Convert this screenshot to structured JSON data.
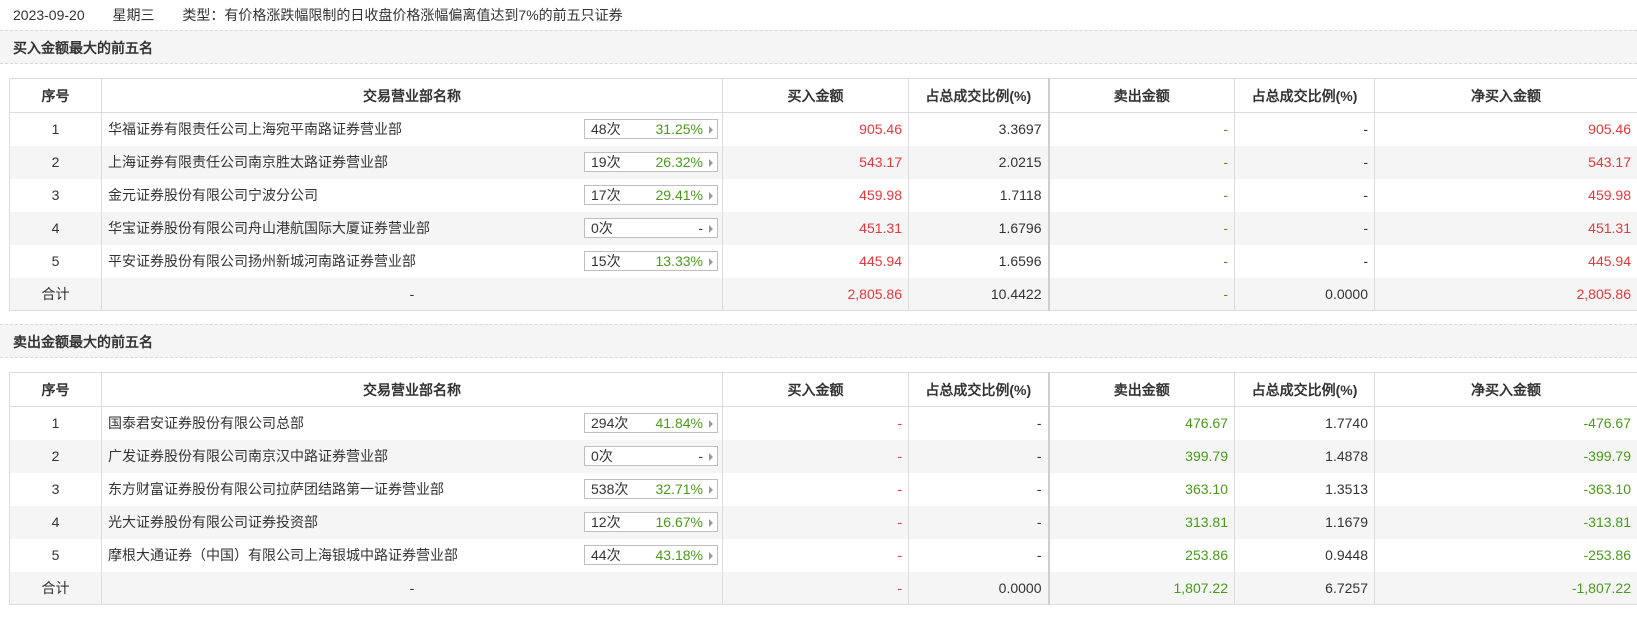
{
  "header": {
    "date": "2023-09-20",
    "weekday": "星期三",
    "type_text": "类型：有价格涨跌幅限制的日收盘价格涨幅偏离值达到7%的前五只证券"
  },
  "columns": [
    "序号",
    "交易营业部名称",
    "买入金额",
    "占总成交比例(%)",
    "卖出金额",
    "占总成交比例(%)",
    "净买入金额"
  ],
  "colors": {
    "red": "#e4393c",
    "green": "#4a9a1a"
  },
  "buy_section": {
    "title": "买入金额最大的前五名",
    "rows": [
      {
        "idx": "1",
        "name": "华福证券有限责任公司上海宛平南路证券营业部",
        "count": "48次",
        "rate": "31.25%",
        "buy": "905.46",
        "buy_pct": "3.3697",
        "sell": "-",
        "sell_pct": "-",
        "net": "905.46"
      },
      {
        "idx": "2",
        "name": "上海证券有限责任公司南京胜太路证券营业部",
        "count": "19次",
        "rate": "26.32%",
        "buy": "543.17",
        "buy_pct": "2.0215",
        "sell": "-",
        "sell_pct": "-",
        "net": "543.17"
      },
      {
        "idx": "3",
        "name": "金元证券股份有限公司宁波分公司",
        "count": "17次",
        "rate": "29.41%",
        "buy": "459.98",
        "buy_pct": "1.7118",
        "sell": "-",
        "sell_pct": "-",
        "net": "459.98"
      },
      {
        "idx": "4",
        "name": "华宝证券股份有限公司舟山港航国际大厦证券营业部",
        "count": "0次",
        "rate": "-",
        "buy": "451.31",
        "buy_pct": "1.6796",
        "sell": "-",
        "sell_pct": "-",
        "net": "451.31"
      },
      {
        "idx": "5",
        "name": "平安证券股份有限公司扬州新城河南路证券营业部",
        "count": "15次",
        "rate": "13.33%",
        "buy": "445.94",
        "buy_pct": "1.6596",
        "sell": "-",
        "sell_pct": "-",
        "net": "445.94"
      }
    ],
    "total": {
      "label": "合计",
      "name": "-",
      "buy": "2,805.86",
      "buy_pct": "10.4422",
      "sell": "-",
      "sell_pct": "0.0000",
      "net": "2,805.86"
    }
  },
  "sell_section": {
    "title": "卖出金额最大的前五名",
    "rows": [
      {
        "idx": "1",
        "name": "国泰君安证券股份有限公司总部",
        "count": "294次",
        "rate": "41.84%",
        "buy": "-",
        "buy_pct": "-",
        "sell": "476.67",
        "sell_pct": "1.7740",
        "net": "-476.67"
      },
      {
        "idx": "2",
        "name": "广发证券股份有限公司南京汉中路证券营业部",
        "count": "0次",
        "rate": "-",
        "buy": "-",
        "buy_pct": "-",
        "sell": "399.79",
        "sell_pct": "1.4878",
        "net": "-399.79"
      },
      {
        "idx": "3",
        "name": "东方财富证券股份有限公司拉萨团结路第一证券营业部",
        "count": "538次",
        "rate": "32.71%",
        "buy": "-",
        "buy_pct": "-",
        "sell": "363.10",
        "sell_pct": "1.3513",
        "net": "-363.10"
      },
      {
        "idx": "4",
        "name": "光大证券股份有限公司证券投资部",
        "count": "12次",
        "rate": "16.67%",
        "buy": "-",
        "buy_pct": "-",
        "sell": "313.81",
        "sell_pct": "1.1679",
        "net": "-313.81"
      },
      {
        "idx": "5",
        "name": "摩根大通证券（中国）有限公司上海银城中路证券营业部",
        "count": "44次",
        "rate": "43.18%",
        "buy": "-",
        "buy_pct": "-",
        "sell": "253.86",
        "sell_pct": "0.9448",
        "net": "-253.86"
      }
    ],
    "total": {
      "label": "合计",
      "name": "-",
      "buy": "-",
      "buy_pct": "0.0000",
      "sell": "1,807.22",
      "sell_pct": "6.7257",
      "net": "-1,807.22"
    }
  }
}
